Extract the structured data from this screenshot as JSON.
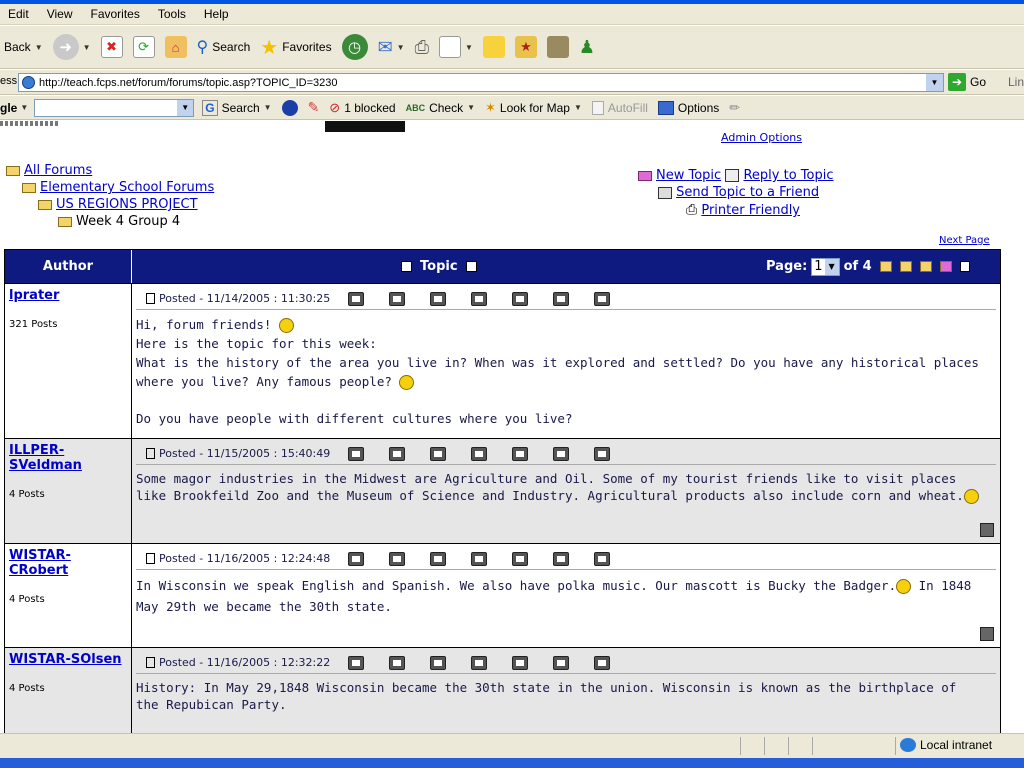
{
  "menu": [
    "Edit",
    "View",
    "Favorites",
    "Tools",
    "Help"
  ],
  "toolbar": {
    "back": "Back",
    "search": "Search",
    "favorites": "Favorites"
  },
  "address": {
    "label": "ess",
    "url": "http://teach.fcps.net/forum/forums/topic.asp?TOPIC_ID=3230",
    "go": "Go",
    "links": "Lin"
  },
  "google": {
    "brand": "gle",
    "search": "Search",
    "blocked": "1 blocked",
    "check": "Check",
    "lookfor": "Look for Map",
    "autofill": "AutoFill",
    "options": "Options"
  },
  "admin": "Admin Options",
  "breadcrumb": {
    "all": "All Forums",
    "elem": "Elementary School Forums",
    "us": "US REGIONS PROJECT",
    "week": "Week 4 Group 4"
  },
  "actions": {
    "new": "New Topic",
    "reply": "Reply to Topic",
    "send": "Send Topic to a Friend",
    "print": "Printer Friendly"
  },
  "next_page": "Next Page",
  "grid": {
    "author": "Author",
    "topic": "Topic",
    "page_label": "Page:",
    "page_value": "1",
    "of": "of 4"
  },
  "posts": [
    {
      "author": "lprater",
      "count": "321 Posts",
      "posted": "Posted - 11/14/2005 :  11:30:25",
      "l1": "Hi, forum friends!",
      "l2": "Here is the topic for this week:",
      "l3": "What is the history of the area you live in? When was it explored and settled? Do you have any historical places where you live? Any famous people?",
      "l4": "Do you have people with different cultures where you live?"
    },
    {
      "author": "ILLPER-SVeldman",
      "count": "4 Posts",
      "posted": "Posted - 11/15/2005 :  15:40:49",
      "l1": "Some magor industries in the Midwest are Agriculture and Oil. Some of my tourist friends like to visit places like Brookfeild Zoo and the Museum of Science and Industry. Agricultural products also include corn and wheat."
    },
    {
      "author": "WISTAR-CRobert",
      "count": "4 Posts",
      "posted": "Posted - 11/16/2005 :  12:24:48",
      "l1": "In Wisconsin we speak English and Spanish. We also have polka music. Our mascott is Bucky the Badger.",
      "l2": "In 1848 May 29th we became the 30th state."
    },
    {
      "author": "WISTAR-SOlsen",
      "count": "4 Posts",
      "posted": "Posted - 11/16/2005 :  12:32:22",
      "l1": "History: In May 29,1848 Wisconsin became the 30th state in the union. Wisconsin is known as the birthplace of the Repubican Party."
    }
  ],
  "status": {
    "zone": "Local intranet"
  }
}
